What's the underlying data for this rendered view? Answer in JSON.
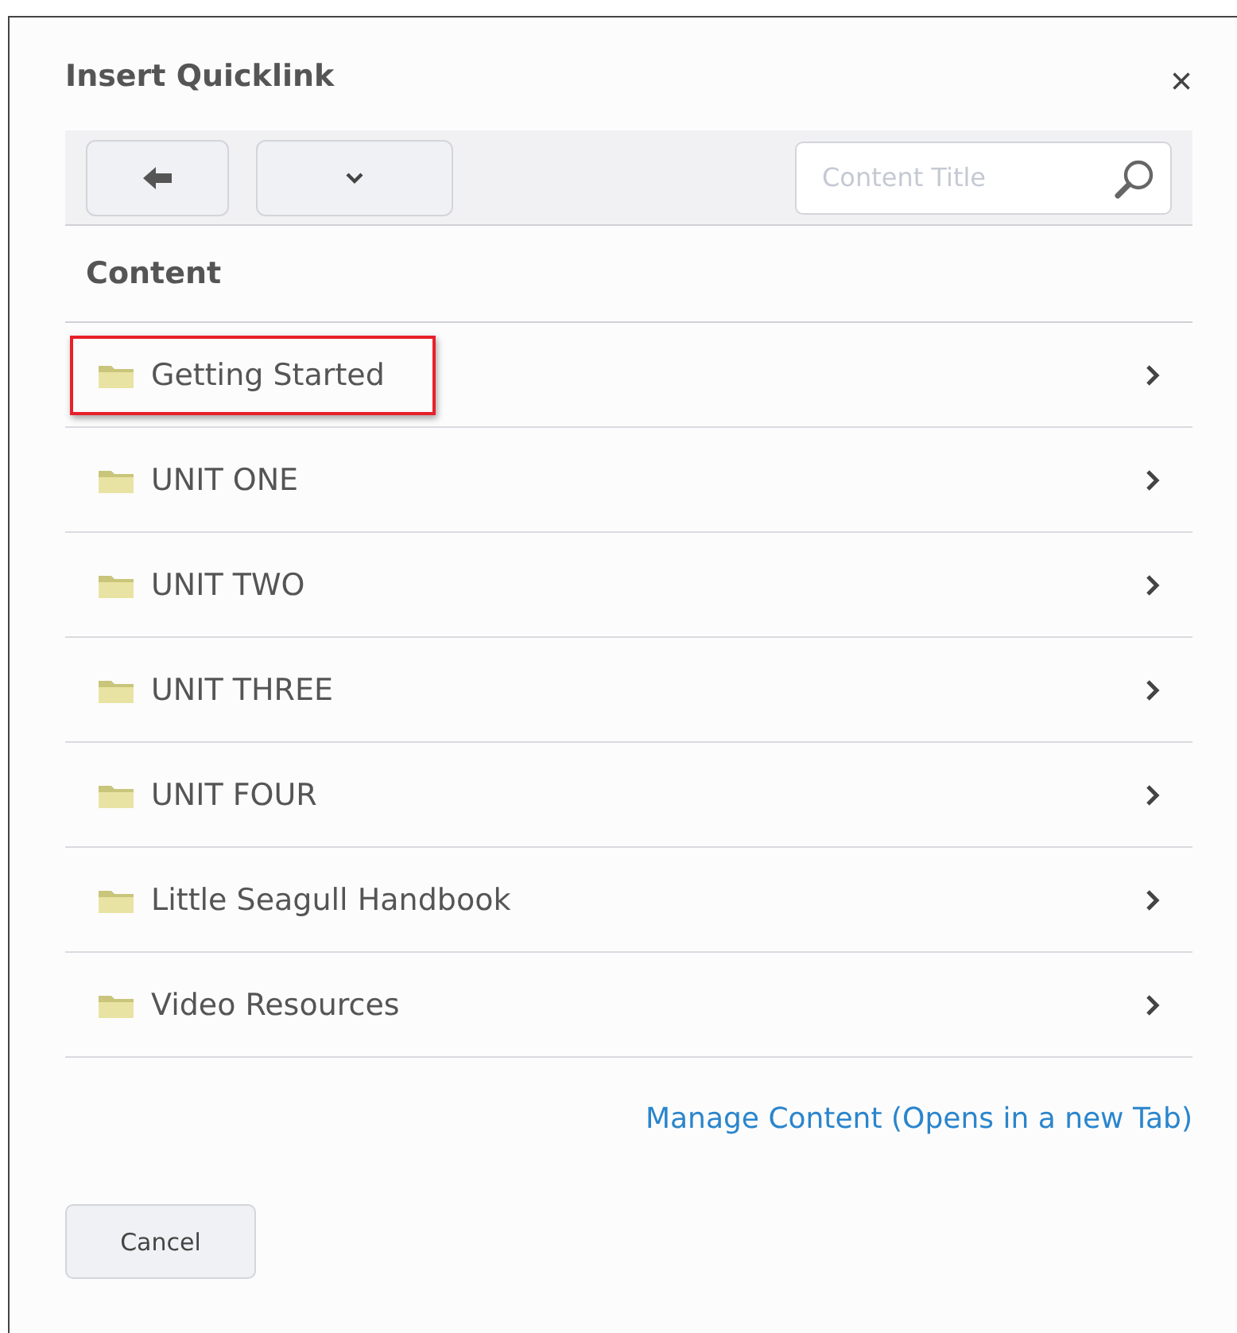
{
  "dialog": {
    "title": "Insert Quicklink",
    "close": "×"
  },
  "search": {
    "placeholder": "Content Title"
  },
  "section_title": "Content",
  "items": [
    {
      "label": "Getting Started",
      "highlighted": true
    },
    {
      "label": "UNIT ONE",
      "highlighted": false
    },
    {
      "label": "UNIT TWO",
      "highlighted": false
    },
    {
      "label": "UNIT THREE",
      "highlighted": false
    },
    {
      "label": "UNIT FOUR",
      "highlighted": false
    },
    {
      "label": "Little Seagull Handbook",
      "highlighted": false
    },
    {
      "label": "Video Resources",
      "highlighted": false
    }
  ],
  "link": "Manage Content (Opens in a new Tab)",
  "buttons": [
    "Cancel"
  ]
}
